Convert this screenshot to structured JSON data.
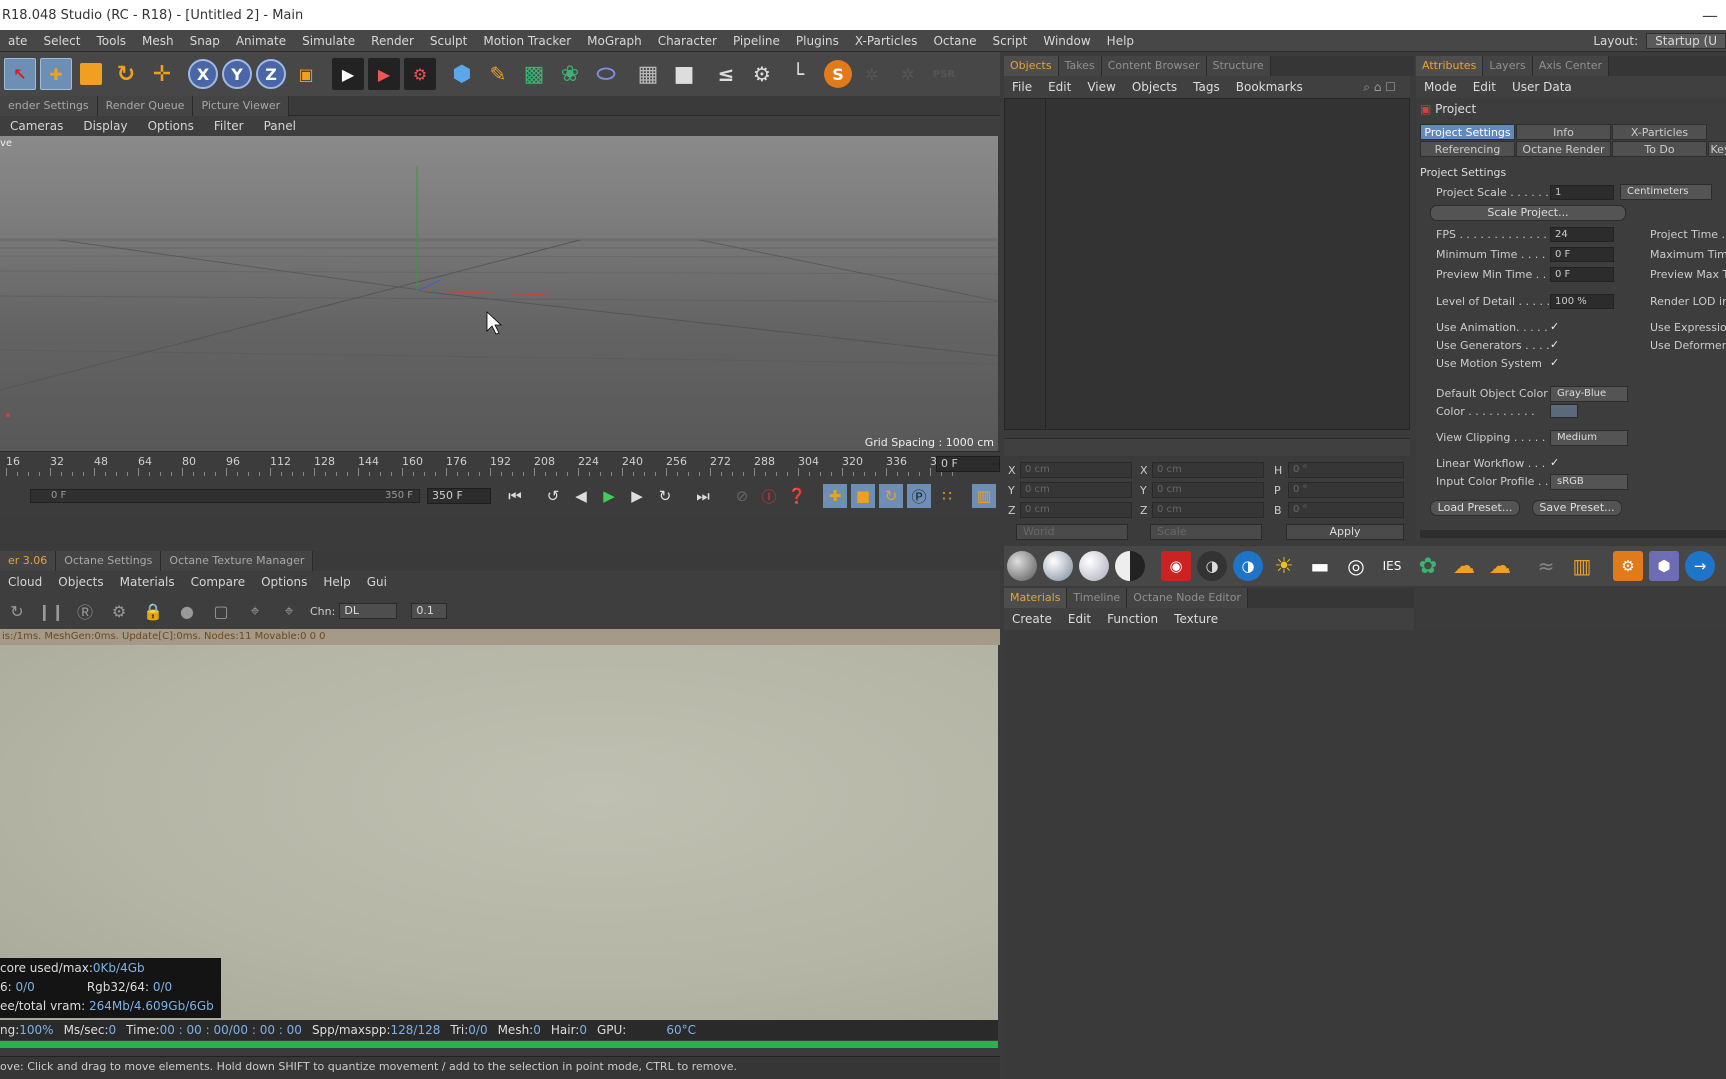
{
  "window": {
    "title": "R18.048 Studio (RC - R18) - [Untitled 2] - Main",
    "minimize": "—"
  },
  "menu": {
    "items": [
      "ate",
      "Select",
      "Tools",
      "Mesh",
      "Snap",
      "Animate",
      "Simulate",
      "Render",
      "Sculpt",
      "Motion Tracker",
      "MoGraph",
      "Character",
      "Pipeline",
      "Plugins",
      "X-Particles",
      "Octane",
      "Script",
      "Window",
      "Help"
    ],
    "layout_label": "Layout:",
    "layout_value": "Startup (U"
  },
  "viewport_tabs": [
    "ender Settings",
    "Render Queue",
    "Picture Viewer"
  ],
  "viewport_menu": [
    "Cameras",
    "Display",
    "Options",
    "Filter",
    "Panel"
  ],
  "viewport_label": "ve",
  "grid_spacing": "Grid Spacing : 1000 cm",
  "ruler_ticks": [
    "16",
    "32",
    "48",
    "64",
    "80",
    "96",
    "112",
    "128",
    "144",
    "160",
    "176",
    "192",
    "208",
    "224",
    "240",
    "256",
    "272",
    "288",
    "304",
    "320",
    "336",
    "35"
  ],
  "current_frame": "0 F",
  "timeline": {
    "start_label": "0 F",
    "end_label": "350 F",
    "end_frame": "350 F"
  },
  "octane_tabs": [
    "er 3.06",
    "Octane Settings",
    "Octane Texture Manager"
  ],
  "octane_menu": [
    "Cloud",
    "Objects",
    "Materials",
    "Compare",
    "Options",
    "Help",
    "Gui"
  ],
  "octane_chn_label": "Chn:",
  "octane_chn_value": "DL",
  "octane_zoom": "0.1",
  "octane_status": "is:/1ms. MeshGen:0ms. Update[C]:0ms. Nodes:11 Movable:0  0 0",
  "mem": [
    {
      "label": "core used/max:",
      "value": "0Kb/4Gb"
    },
    {
      "label": "6: ",
      "value": "0/0",
      "label2": "Rgb32/64: ",
      "value2": "0/0"
    },
    {
      "label": "ee/total vram: ",
      "value": "264Mb/4.609Gb/6Gb"
    }
  ],
  "render_info": [
    {
      "label": "ng: ",
      "value": "100%"
    },
    {
      "label": "Ms/sec: ",
      "value": "0"
    },
    {
      "label": "Time: ",
      "value": "00 : 00 : 00/00 : 00 : 00"
    },
    {
      "label": "Spp/maxspp: ",
      "value": "128/128"
    },
    {
      "label": "Tri: ",
      "value": "0/0"
    },
    {
      "label": "Mesh: ",
      "value": "0"
    },
    {
      "label": "Hair: ",
      "value": "0"
    },
    {
      "label": "GPU: ",
      "value": ""
    },
    {
      "label": "",
      "value": "60°C"
    }
  ],
  "status_bar": "ove: Click and drag to move elements. Hold down SHIFT to quantize movement / add to the selection in point mode, CTRL to remove.",
  "objects_tabs": [
    "Objects",
    "Takes",
    "Content Browser",
    "Structure"
  ],
  "objects_menu": [
    "File",
    "Edit",
    "View",
    "Objects",
    "Tags",
    "Bookmarks"
  ],
  "coords": {
    "rows": [
      {
        "a": "X",
        "av": "0 cm",
        "b": "X",
        "bv": "0 cm",
        "c": "H",
        "cv": "0 °"
      },
      {
        "a": "Y",
        "av": "0 cm",
        "b": "Y",
        "bv": "0 cm",
        "c": "P",
        "cv": "0 °"
      },
      {
        "a": "Z",
        "av": "0 cm",
        "b": "Z",
        "bv": "0 cm",
        "c": "B",
        "cv": "0 °"
      }
    ],
    "world": "World",
    "scale": "Scale",
    "apply": "Apply"
  },
  "materials_tabs": [
    "Materials",
    "Timeline",
    "Octane Node Editor"
  ],
  "materials_menu": [
    "Create",
    "Edit",
    "Function",
    "Texture"
  ],
  "attributes_tabs": [
    "Attributes",
    "Layers",
    "Axis Center"
  ],
  "attributes_menu": [
    "Mode",
    "Edit",
    "User Data"
  ],
  "project": {
    "header": "Project",
    "tabs_row1": [
      "Project Settings",
      "Info",
      "X-Particles"
    ],
    "tabs_row2": [
      "Referencing",
      "Octane Render",
      "To Do",
      "Key"
    ],
    "section": "Project Settings",
    "scale_label": "Project Scale . . . . . .",
    "scale_value": "1",
    "scale_unit": "Centimeters",
    "scale_button": "Scale Project...",
    "fps_label": "FPS . . . . . . . . . . . . . .",
    "fps_value": "24",
    "project_time_label": "Project Time . .",
    "min_time_label": "Minimum Time . . . .",
    "min_time_value": "0 F",
    "max_time_label": "Maximum Time",
    "preview_min_label": "Preview Min Time . .",
    "preview_min_value": "0 F",
    "preview_max_label": "Preview Max Ti",
    "lod_label": "Level of Detail . . . . .",
    "lod_value": "100 %",
    "render_lod_label": "Render LOD in",
    "use_animation": "Use Animation. . . . .",
    "use_expression": "Use Expression",
    "use_generators": "Use Generators . . . .",
    "use_deformers": "Use Deformers",
    "use_motion": "Use Motion System",
    "default_color_label": "Default Object Color",
    "default_color_value": "Gray-Blue",
    "color_label": "Color . . . . . . . . . .",
    "view_clipping_label": "View Clipping . . . . .",
    "view_clipping_value": "Medium",
    "linear_workflow": "Linear Workflow . . .",
    "input_color_label": "Input Color Profile . .",
    "input_color_value": "sRGB",
    "load_preset": "Load Preset...",
    "save_preset": "Save Preset...",
    "check": "✓"
  }
}
